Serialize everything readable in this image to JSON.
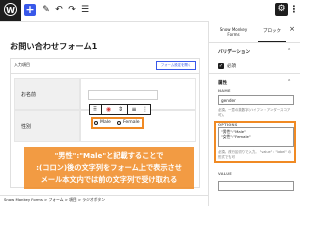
{
  "toolbar": {
    "add_label": "+",
    "icons": [
      "pencil-icon",
      "undo-icon",
      "redo-icon",
      "list-view-icon"
    ],
    "settings_icon": "gear-icon",
    "more_icon": "more-vertical-icon"
  },
  "sidebar": {
    "tab_form": "Snow Monkey\nForms",
    "tab_block": "ブロック",
    "close": "×",
    "validation_heading": "バリデーション",
    "required_label": "必須",
    "attributes_heading": "属性",
    "name_label": "NAME",
    "name_value": "gender",
    "name_help": "必須。一意の英数字(ハイフン・アンダースコア可)。",
    "options_label": "OPTIONS",
    "options_value": "\"男性\":\"Male\"\n\"女性\":\"Female\"",
    "options_help": "必須。改行区切りで入力。 \"value\" : \"label\" の形式でも可",
    "value_label": "VALUE"
  },
  "canvas": {
    "page_title": "お問い合わせフォーム1",
    "card_title": "入力項目",
    "card_link": "フォーム設定を開く",
    "rows": [
      {
        "label": "お名前"
      },
      {
        "label": "性別"
      }
    ],
    "radio_options": [
      "Male",
      "Female"
    ]
  },
  "annotation": {
    "lines": [
      "\"男性\":\"Male\"と記載することで",
      ":(コロン)後の文字列をフォーム上で表示させ",
      "メール本文内では前の文字列で受け取れる"
    ]
  },
  "breadcrumb": "Snow Monkey Forms  >  フォーム  >  項目  >  ラジオボタン",
  "colors": {
    "accent": "#3858e9",
    "highlight": "#f08a24",
    "dark": "#1e1e1e"
  }
}
